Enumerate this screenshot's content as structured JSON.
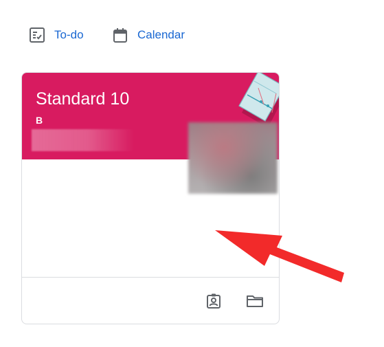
{
  "nav": {
    "todo_label": "To-do",
    "calendar_label": "Calendar",
    "todo_icon": "todo-icon",
    "calendar_icon": "calendar-icon"
  },
  "card": {
    "title": "Standard 10",
    "section": "B",
    "header_color": "#d81b60",
    "footer_icons": [
      "assignment-ind-icon",
      "folder-icon"
    ]
  },
  "colors": {
    "link": "#1967d2",
    "arrow": "#f22a2a",
    "icon": "#5f6368"
  }
}
